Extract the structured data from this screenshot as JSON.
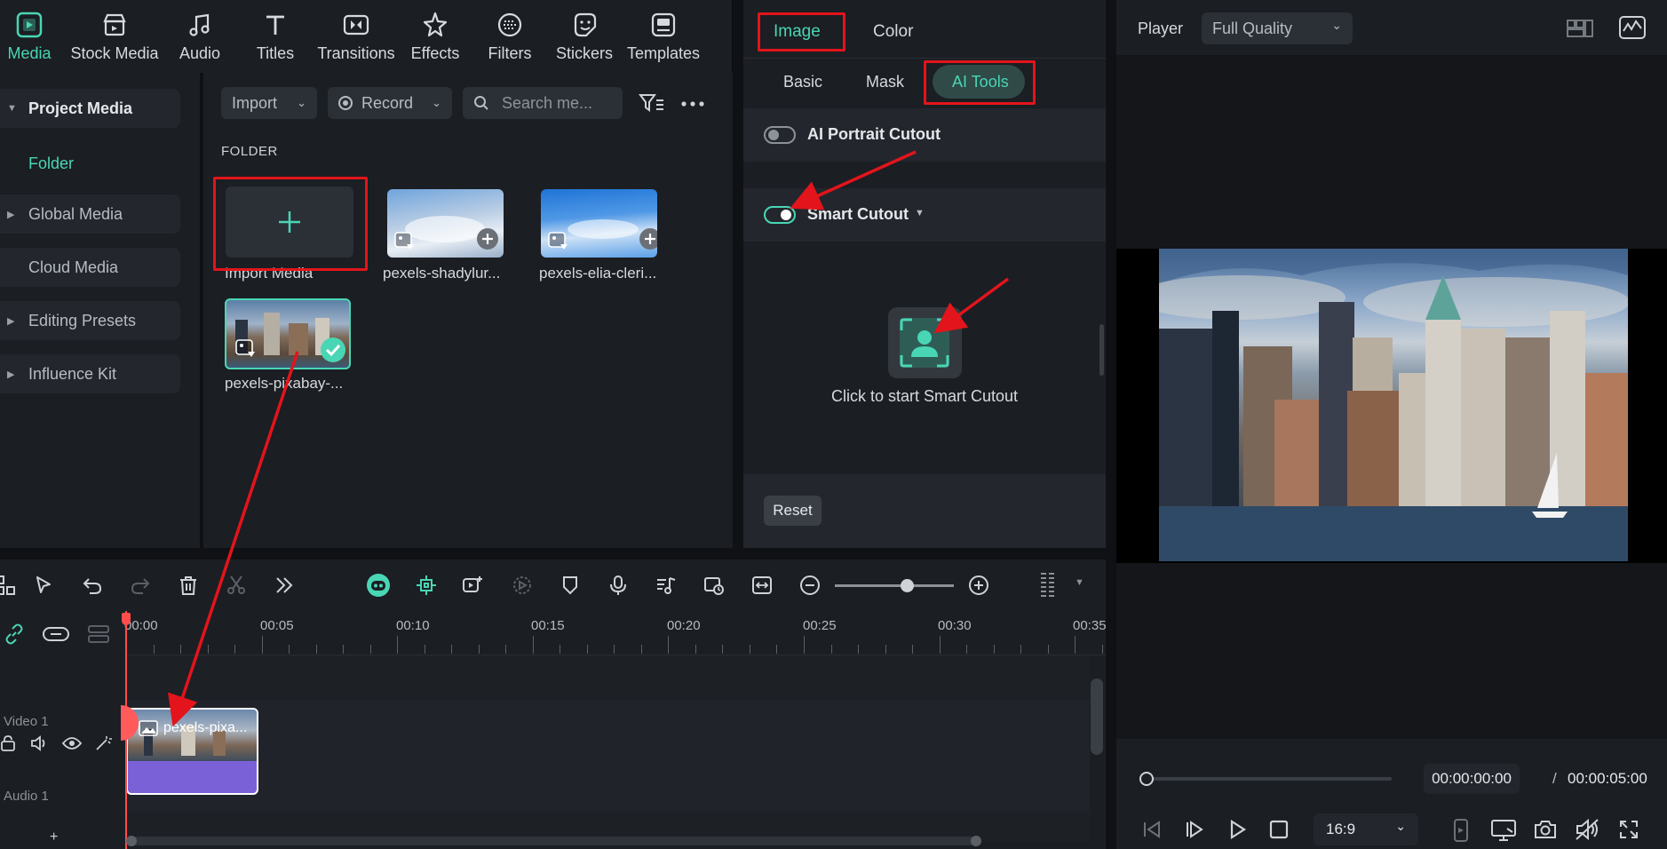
{
  "toolbar": {
    "items": [
      {
        "label": "Media",
        "icon": "media-icon",
        "active": true
      },
      {
        "label": "Stock Media",
        "icon": "stock-media-icon"
      },
      {
        "label": "Audio",
        "icon": "audio-note-icon"
      },
      {
        "label": "Titles",
        "icon": "titles-t-icon"
      },
      {
        "label": "Transitions",
        "icon": "transitions-icon"
      },
      {
        "label": "Effects",
        "icon": "effects-star-icon"
      },
      {
        "label": "Filters",
        "icon": "filters-icon"
      },
      {
        "label": "Stickers",
        "icon": "stickers-icon"
      },
      {
        "label": "Templates",
        "icon": "templates-icon"
      }
    ]
  },
  "sidebar": {
    "items": [
      {
        "label": "Project Media"
      },
      {
        "label": "Folder"
      },
      {
        "label": "Global Media"
      },
      {
        "label": "Cloud Media"
      },
      {
        "label": "Editing Presets"
      },
      {
        "label": "Influence Kit"
      }
    ]
  },
  "media": {
    "import_label": "Import",
    "record_label": "Record",
    "search_placeholder": "Search me...",
    "folder_heading": "FOLDER",
    "import_media_label": "Import Media",
    "items": [
      {
        "label": "pexels-shadylur..."
      },
      {
        "label": "pexels-elia-cleri..."
      },
      {
        "label": "pexels-pixabay-..."
      }
    ]
  },
  "properties": {
    "tabs": [
      "Image",
      "Color"
    ],
    "subtabs": [
      "Basic",
      "Mask",
      "AI Tools"
    ],
    "ai_portrait": "AI Portrait Cutout",
    "smart_cutout": "Smart Cutout",
    "smart_cutout_hint": "Click to start Smart Cutout",
    "reset_label": "Reset"
  },
  "player": {
    "title": "Player",
    "quality": "Full Quality",
    "current_time": "00:00:00:00",
    "separator": "/",
    "total_time": "00:00:05:00",
    "aspect": "16:9"
  },
  "timeline": {
    "ticks": [
      "00:00",
      "00:05",
      "00:10",
      "00:15",
      "00:20",
      "00:25",
      "00:30",
      "00:35"
    ],
    "video_track": "Video 1",
    "audio_track": "Audio 1",
    "clip_label": "pexels-pixa...",
    "add_label": "+"
  },
  "colors": {
    "accent": "#49d6b4",
    "annotation_red": "#e3141b",
    "clip_purple": "#7b61d8"
  }
}
